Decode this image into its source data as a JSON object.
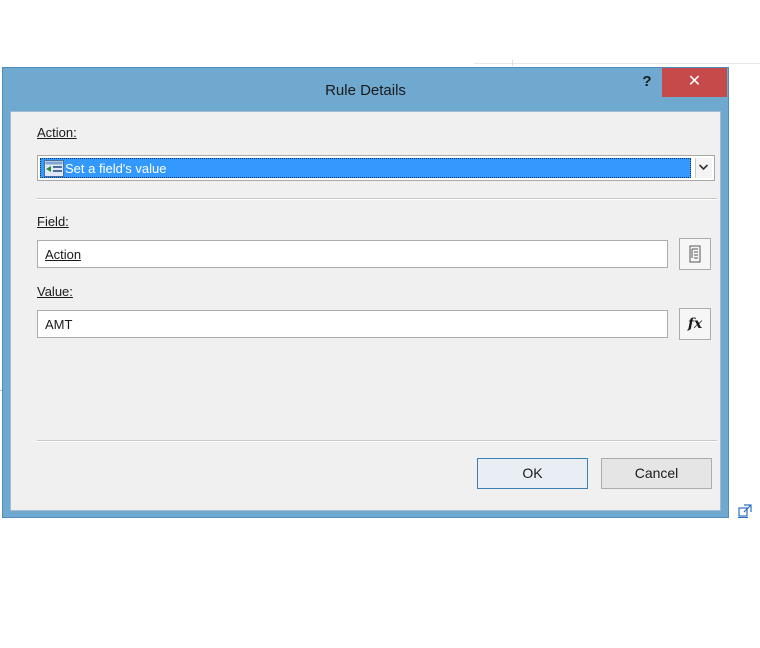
{
  "dialog": {
    "title": "Rule Details",
    "help_label": "?",
    "close_label": "✕"
  },
  "action": {
    "label": "Action:",
    "selected_value": "Set a field's value"
  },
  "field": {
    "label": "Field:",
    "value": "Action",
    "picker_icon": "field-tree-icon"
  },
  "value": {
    "label": "Value:",
    "value": "AMT",
    "formula_label": "fx"
  },
  "buttons": {
    "ok": "OK",
    "cancel": "Cancel"
  },
  "colors": {
    "titlebar": "#6fa9d0",
    "close": "#c74a4a",
    "selection": "#3399ff"
  }
}
